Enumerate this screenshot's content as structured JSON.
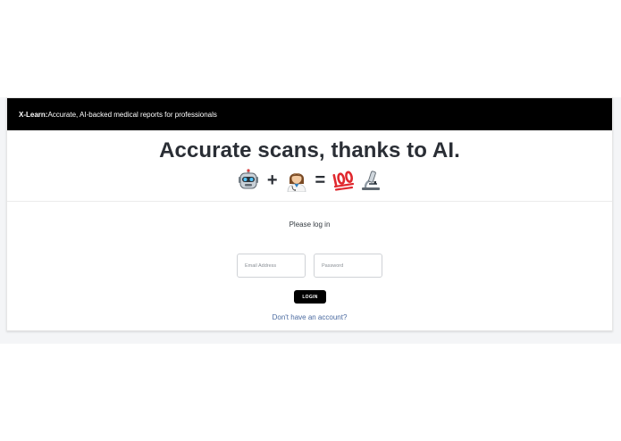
{
  "header": {
    "brand": "X-Learn:",
    "tagline": "Accurate, AI-backed medical reports for professionals"
  },
  "hero": {
    "headline": "Accurate scans, thanks to AI.",
    "equation": {
      "icons": [
        "robot-icon",
        "doctor-icon",
        "hundred-points-icon",
        "microscope-icon"
      ],
      "plus": "+",
      "equals": "="
    }
  },
  "login": {
    "prompt": "Please log in",
    "email_placeholder": "Email Address",
    "password_placeholder": "Password",
    "button_label": "LOGIN",
    "signup_link": "Don't have an account?"
  },
  "colors": {
    "topbar": "#000000",
    "text": "#2a2e35",
    "link": "#4a6aa0",
    "page_background": "#f4f5f7"
  }
}
